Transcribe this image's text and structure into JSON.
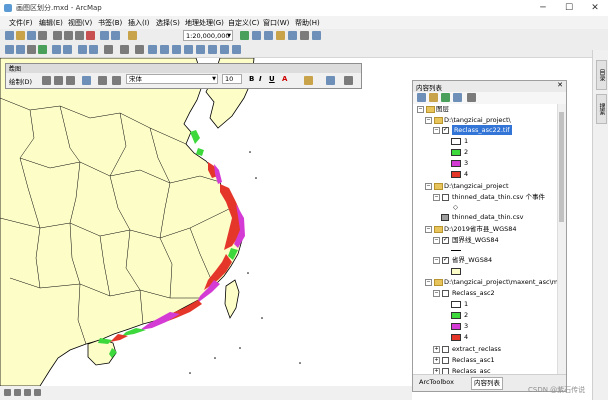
{
  "window": {
    "title": "画图区划分.mxd - ArcMap"
  },
  "menu": [
    "文件(F)",
    "编辑(E)",
    "视图(V)",
    "书签(B)",
    "插入(I)",
    "选择(S)",
    "地理处理(G)",
    "自定义(C)",
    "窗口(W)",
    "帮助(H)"
  ],
  "toolbar": {
    "scale": "1:20,000,000"
  },
  "draw_toolbar": {
    "title": "绘图",
    "label": "绘制(D)",
    "font": "宋体",
    "size": "10",
    "bold": "B",
    "italic": "I",
    "underline": "U",
    "font_color_glyph": "A"
  },
  "toc": {
    "title": "内容列表",
    "root": "图层",
    "groups": [
      {
        "path": "D:\\tangzicai_project\\",
        "layer": "Reclass_asc22.tif",
        "classes": [
          "1",
          "2",
          "3",
          "4"
        ]
      },
      {
        "path": "D:\\tangzicai_project",
        "layer": "thinned_data_thin.csv 个事件",
        "marker": "◇",
        "layer2": "thinned_data_thin.csv"
      },
      {
        "path": "D:\\2019省市县_WGS84",
        "layer": "国界线_WGS84",
        "layer2": "省界_WGS84"
      },
      {
        "path": "D:\\tangzicai_project\\maxent_asc\\ma",
        "layer": "Reclass_asc2",
        "classes": [
          "1",
          "2",
          "3",
          "4"
        ],
        "extra_layers": [
          "extract_reclass",
          "Reclass_asc1",
          "Reclass_asc"
        ]
      }
    ],
    "tabs": [
      "ArcToolbox",
      "内容列表"
    ]
  },
  "right_tabs": [
    "目录",
    "搜索"
  ],
  "colors": {
    "class1": "#ffffff",
    "class2": "#3cd83c",
    "class3": "#d43bd4",
    "class4": "#e5362a",
    "land": "#fdfdc8",
    "sea": "#ffffff"
  },
  "watermark": "CSDN @紫石传说"
}
